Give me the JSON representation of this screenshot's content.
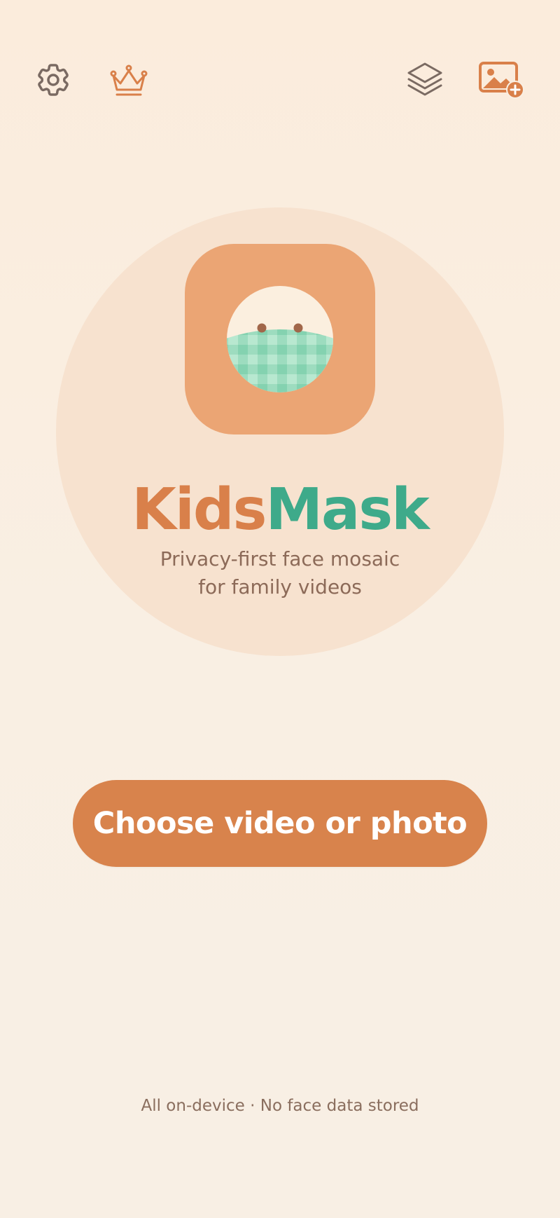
{
  "app": {
    "name_part_1": "Kids",
    "name_part_2": "Mask",
    "tagline_line_1": "Privacy-first face mosaic",
    "tagline_line_2": "for family videos"
  },
  "toolbar": {
    "left": [
      {
        "icon": "gear-icon",
        "name": "settings"
      },
      {
        "icon": "crown-icon",
        "name": "premium"
      }
    ],
    "right": [
      {
        "icon": "layers-icon",
        "name": "layers"
      },
      {
        "icon": "add-image-icon",
        "name": "add-image"
      }
    ]
  },
  "main": {
    "cta_label": "Choose video or photo"
  },
  "footer": {
    "note": "All on-device · No face data stored"
  },
  "colors": {
    "background": "#f9efe3",
    "hero_circle": "#f7e2cf",
    "app_icon": "#eba574",
    "accent_orange": "#d8834c",
    "accent_green": "#3eaa8a",
    "text_muted": "#8c6a58",
    "icon_gray": "#7a6a62"
  }
}
